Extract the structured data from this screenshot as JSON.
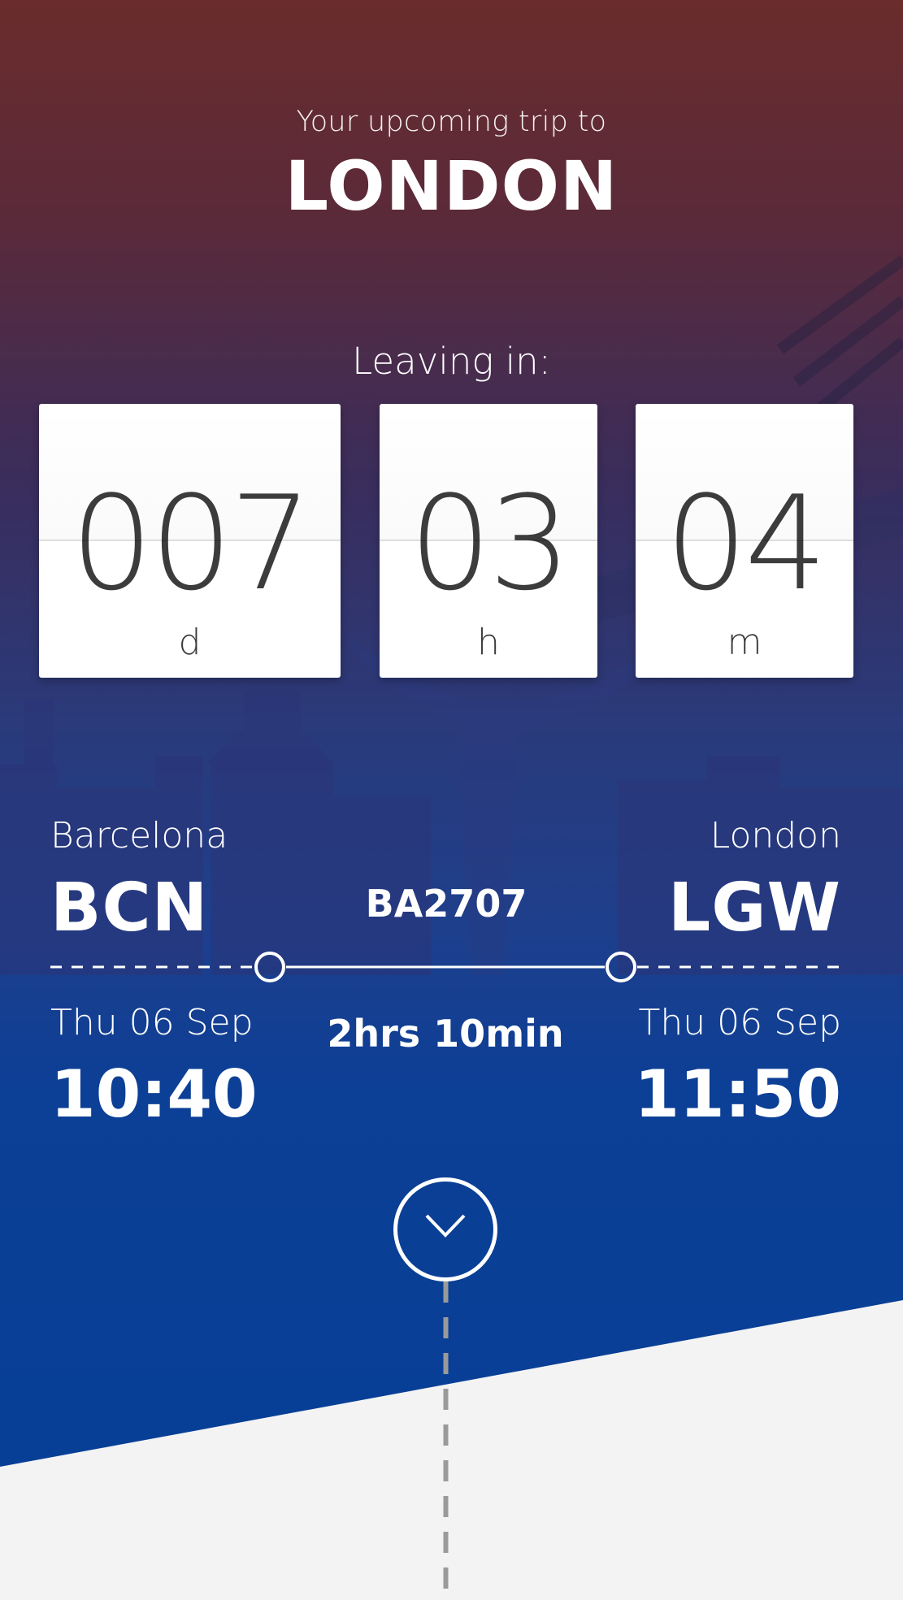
{
  "header": {
    "subtitle": "Your upcoming trip to",
    "destination": "LONDON"
  },
  "countdown": {
    "label": "Leaving in:",
    "days": {
      "value": "007",
      "unit": "d"
    },
    "hours": {
      "value": "03",
      "unit": "h"
    },
    "minutes": {
      "value": "04",
      "unit": "m"
    }
  },
  "flight": {
    "number": "BA2707",
    "duration": "2hrs 10min",
    "origin": {
      "city": "Barcelona",
      "code": "BCN",
      "date": "Thu 06 Sep",
      "time": "10:40"
    },
    "destination": {
      "city": "London",
      "code": "LGW",
      "date": "Thu 06 Sep",
      "time": "11:50"
    }
  },
  "icons": {
    "expand": "chevron-down-icon"
  },
  "colors": {
    "brand_blue": "#063f96",
    "top_red": "#6a2c2c",
    "light_bg": "#f3f3f4",
    "card_text": "#3c3c3c"
  }
}
